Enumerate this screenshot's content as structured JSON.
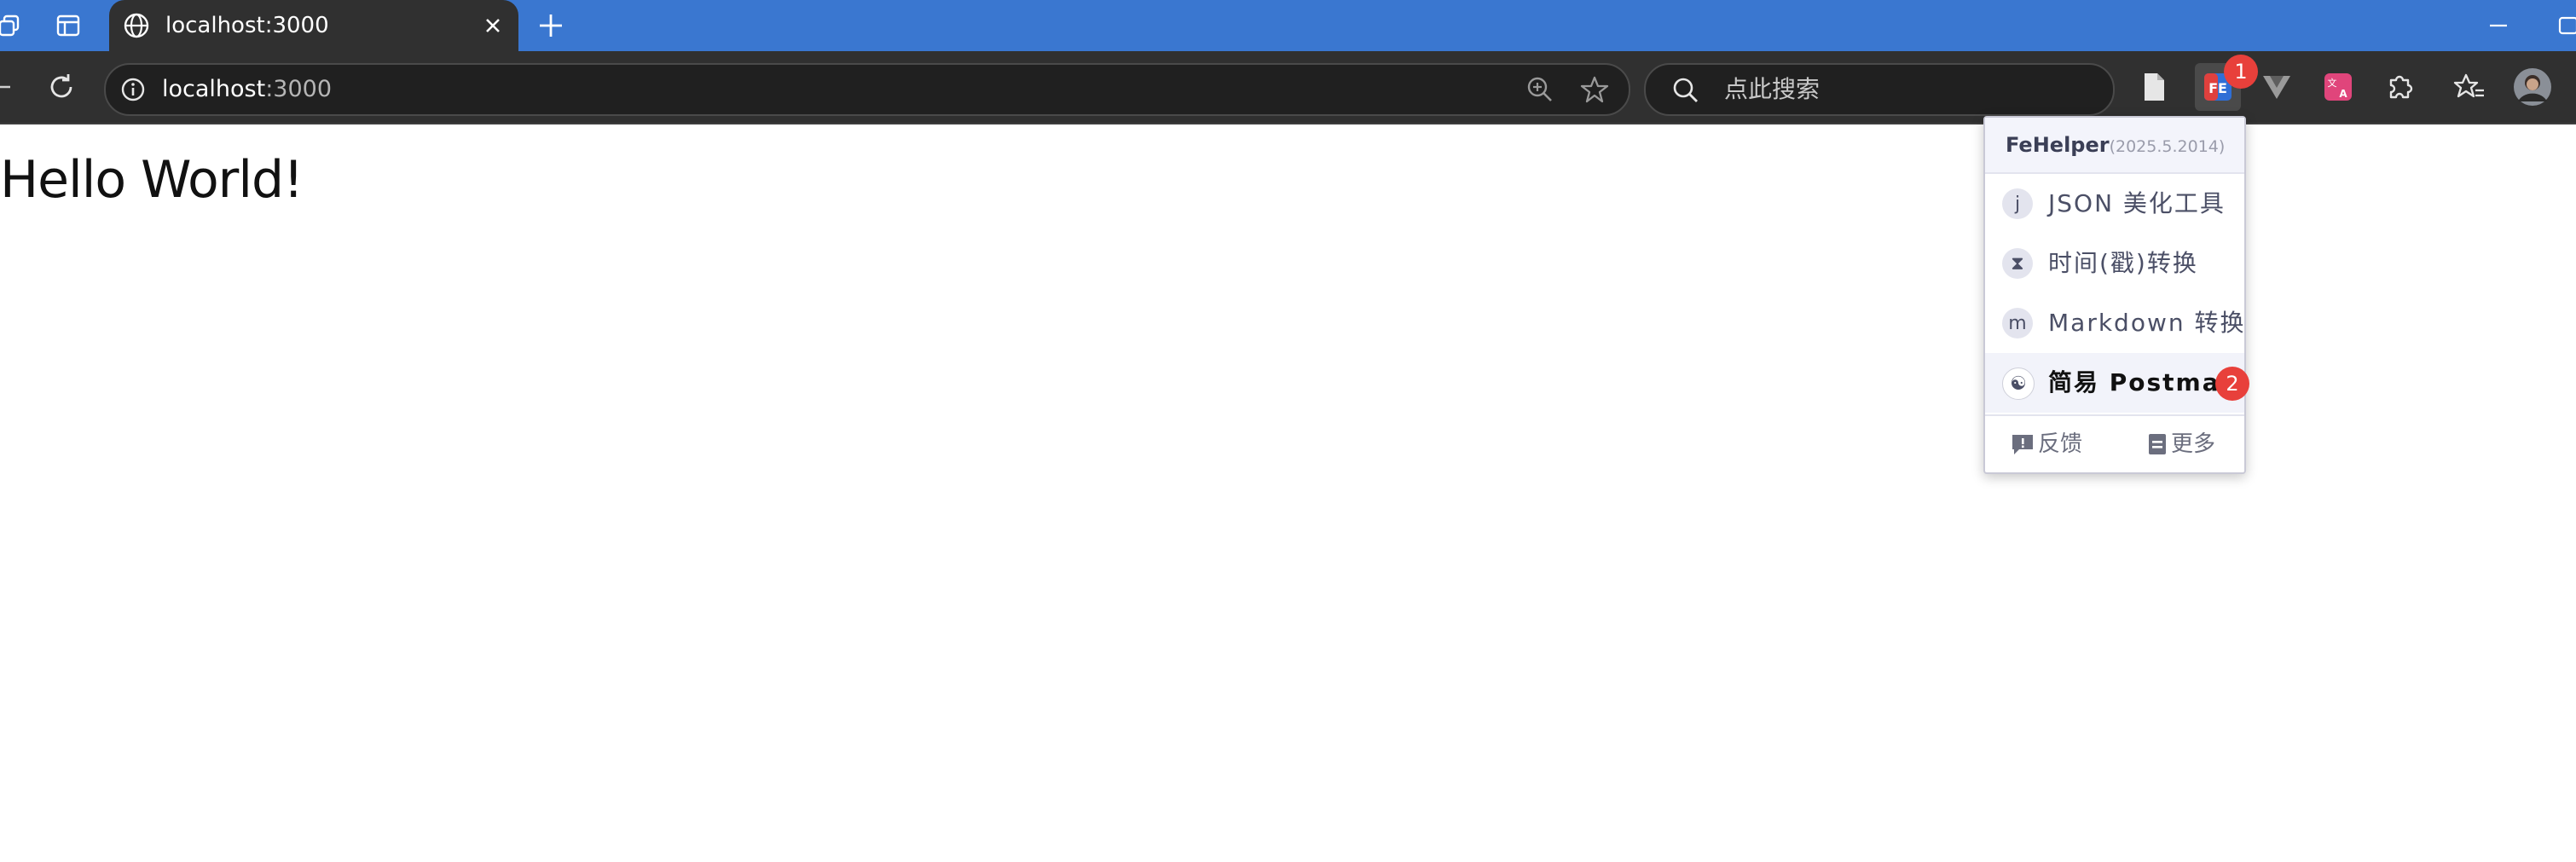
{
  "browser": {
    "tab": {
      "title": "localhost:3000"
    },
    "address": {
      "host": "localhost",
      "port": ":3000"
    },
    "search": {
      "placeholder": "点此搜索"
    },
    "extension_badge": "1"
  },
  "page": {
    "heading": "Hello World!"
  },
  "popup": {
    "title": "FeHelper",
    "version": "(2025.5.2014)",
    "items": [
      {
        "label": "JSON 美化工具",
        "icon": "json-icon",
        "glyph": "j"
      },
      {
        "label": "时间(戳)转换",
        "icon": "hourglass-icon",
        "glyph": "⧗"
      },
      {
        "label": "Markdown 转换",
        "icon": "markdown-icon",
        "glyph": "m"
      },
      {
        "label": "简易 Postman",
        "icon": "yin-yang-icon",
        "glyph": "☯"
      }
    ],
    "active_badge": "2",
    "footer": {
      "feedback": "反馈",
      "more": "更多"
    }
  },
  "colors": {
    "tabstrip": "#3a77d0",
    "toolbar": "#303030",
    "badge": "#e8403b"
  }
}
